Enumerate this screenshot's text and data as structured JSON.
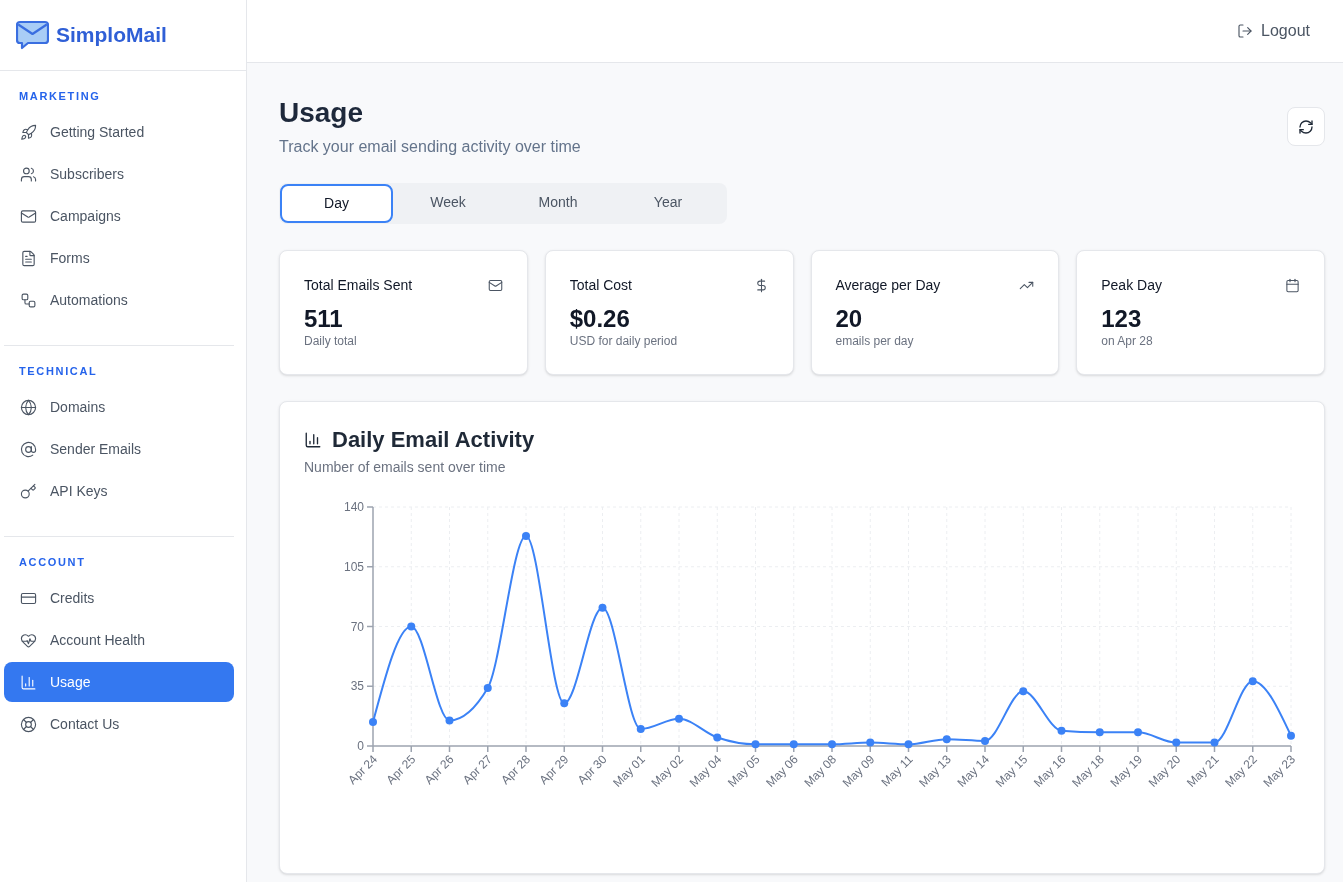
{
  "brand": {
    "name": "SimploMail"
  },
  "sidebar": {
    "sections": [
      {
        "heading": "MARKETING",
        "items": [
          {
            "label": "Getting Started",
            "selected": false
          },
          {
            "label": "Subscribers",
            "selected": false
          },
          {
            "label": "Campaigns",
            "selected": false
          },
          {
            "label": "Forms",
            "selected": false
          },
          {
            "label": "Automations",
            "selected": false
          }
        ]
      },
      {
        "heading": "TECHNICAL",
        "items": [
          {
            "label": "Domains",
            "selected": false
          },
          {
            "label": "Sender Emails",
            "selected": false
          },
          {
            "label": "API Keys",
            "selected": false
          }
        ]
      },
      {
        "heading": "ACCOUNT",
        "items": [
          {
            "label": "Credits",
            "selected": false
          },
          {
            "label": "Account Health",
            "selected": false
          },
          {
            "label": "Usage",
            "selected": true
          },
          {
            "label": "Contact Us",
            "selected": false
          }
        ]
      }
    ]
  },
  "header": {
    "logout": "Logout"
  },
  "page": {
    "title": "Usage",
    "subtitle": "Track your email sending activity over time"
  },
  "tabs": [
    {
      "label": "Day",
      "selected": true
    },
    {
      "label": "Week",
      "selected": false
    },
    {
      "label": "Month",
      "selected": false
    },
    {
      "label": "Year",
      "selected": false
    }
  ],
  "stats": [
    {
      "label": "Total Emails Sent",
      "value": "511",
      "note": "Daily total"
    },
    {
      "label": "Total Cost",
      "value": "$0.26",
      "note": "USD for daily period"
    },
    {
      "label": "Average per Day",
      "value": "20",
      "note": "emails per day"
    },
    {
      "label": "Peak Day",
      "value": "123",
      "note": "on Apr 28"
    }
  ],
  "chart_card": {
    "title": "Daily Email Activity",
    "subtitle": "Number of emails sent over time",
    "chart_data": {
      "type": "line",
      "grid": true,
      "categories": [
        "Apr 24",
        "Apr 25",
        "Apr 26",
        "Apr 27",
        "Apr 28",
        "Apr 29",
        "Apr 30",
        "May 01",
        "May 02",
        "May 04",
        "May 05",
        "May 06",
        "May 08",
        "May 09",
        "May 11",
        "May 13",
        "May 14",
        "May 15",
        "May 16",
        "May 18",
        "May 19",
        "May 20",
        "May 21",
        "May 22",
        "May 23"
      ],
      "series": [
        {
          "color": "#3b82f6",
          "marker": true,
          "values": [
            14,
            70,
            15,
            34,
            123,
            25,
            81,
            10,
            16,
            5,
            1,
            1,
            1,
            2,
            1,
            4,
            3,
            32,
            9,
            8,
            8,
            2,
            2,
            38,
            6
          ]
        }
      ],
      "ylim": [
        0,
        140
      ],
      "yticks": [
        0,
        35,
        70,
        105,
        140
      ]
    }
  }
}
